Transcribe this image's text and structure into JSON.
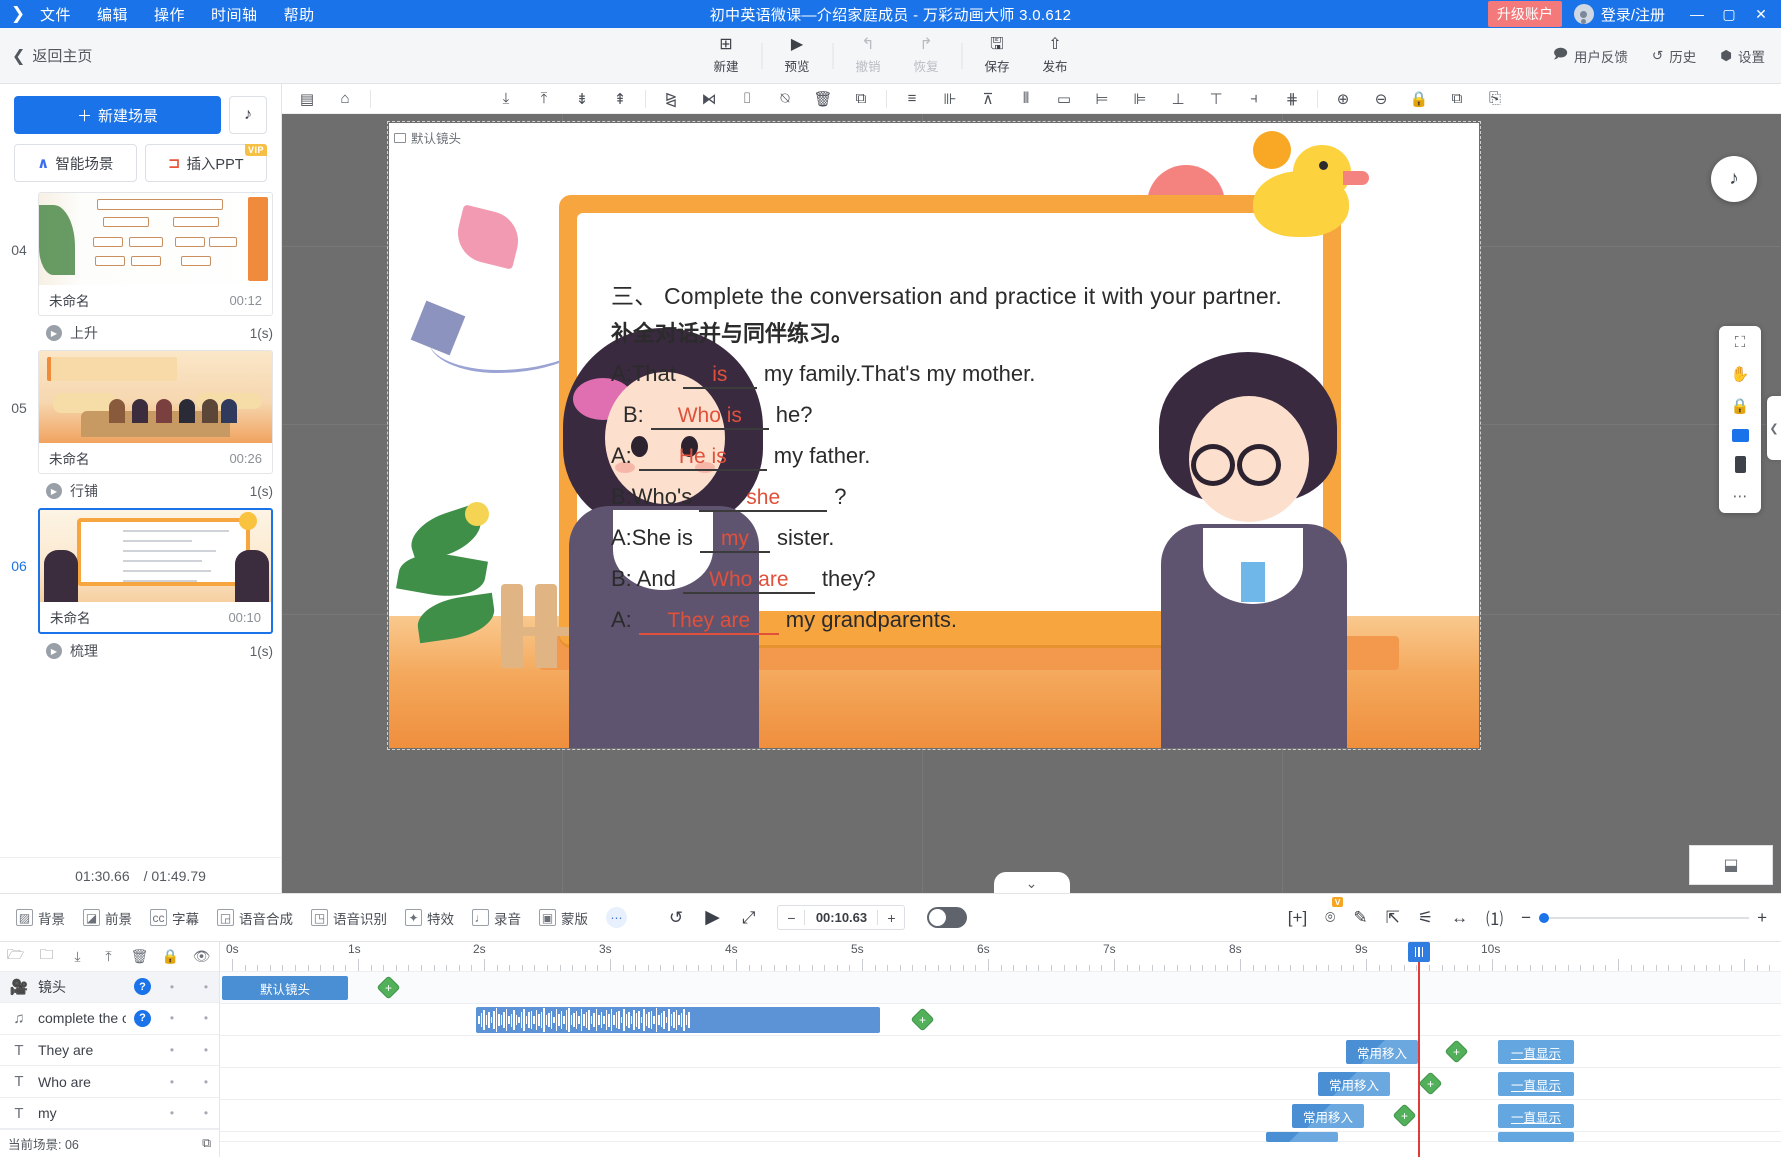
{
  "titlebar": {
    "menus": [
      "文件",
      "编辑",
      "操作",
      "时间轴",
      "帮助"
    ],
    "window_title": "初中英语微课—介绍家庭成员 - 万彩动画大师 3.0.612",
    "upgrade_label": "升级账户",
    "account_label": "登录/注册",
    "minimize": "—",
    "maximize": "▢",
    "close": "✕",
    "accent": "#1a73e8",
    "upgrade_color": "#f4797b"
  },
  "toolbar": {
    "back_label": "返回主页",
    "items": [
      {
        "label": "新建",
        "icon": "plus-square-icon",
        "disabled": false
      },
      {
        "label": "预览",
        "icon": "play-icon",
        "disabled": false
      },
      {
        "label": "撤销",
        "icon": "undo-icon",
        "disabled": true
      },
      {
        "label": "恢复",
        "icon": "redo-icon",
        "disabled": true
      },
      {
        "label": "保存",
        "icon": "save-icon",
        "disabled": false
      },
      {
        "label": "发布",
        "icon": "upload-icon",
        "disabled": false
      }
    ],
    "right_items": [
      {
        "label": "用户反馈",
        "icon": "feedback-icon"
      },
      {
        "label": "历史",
        "icon": "history-icon"
      },
      {
        "label": "设置",
        "icon": "gear-icon"
      }
    ]
  },
  "left_panel": {
    "new_scene_label": "新建场景",
    "music_icon": "music-note-icon",
    "smart_scene_label": "智能场景",
    "insert_ppt_label": "插入PPT",
    "vip_badge": "VIP",
    "scenes": [
      {
        "num": "04",
        "name": "未命名",
        "duration": "00:12",
        "transition": "上升",
        "trans_time": "1(s)",
        "selected": false
      },
      {
        "num": "05",
        "name": "未命名",
        "duration": "00:26",
        "transition": "行铺",
        "trans_time": "1(s)",
        "selected": false
      },
      {
        "num": "06",
        "name": "未命名",
        "duration": "00:10",
        "transition": "梳理",
        "trans_time": "1(s)",
        "selected": true
      }
    ],
    "current_time": "01:30.66",
    "total_time": "/ 01:49.79"
  },
  "canvas_tools": {
    "left_icons": [
      "layout-icon",
      "home-icon"
    ],
    "icons": [
      "align-bottom-icon",
      "align-top-icon",
      "push-down-icon",
      "push-up-icon",
      "flip-horizontal-icon",
      "flip-vertical-icon",
      "lock-icon",
      "unlock-icon",
      "delete-icon",
      "select-all-icon",
      "align-left-icon",
      "align-center-icon",
      "distribute-icon",
      "align-right-icon",
      "crop-icon",
      "indent-left-icon",
      "indent-right-icon",
      "align-middle-icon",
      "align-v-top-icon",
      "align-v-bottom-icon",
      "distribute-v-icon",
      "zoom-in-icon",
      "zoom-out-icon",
      "lock2-icon",
      "copy-icon",
      "paste-icon"
    ]
  },
  "slide": {
    "camera_tag": "默认镜头",
    "heading_num": "三、",
    "heading_en": "Complete the conversation and practice it with your partner.",
    "heading_cn": "补全对话并与同伴练习。",
    "lines": [
      {
        "pre": "A:That",
        "blank": "is",
        "post": "my family.That's my mother."
      },
      {
        "pre": "B:",
        "blank": "Who is",
        "post": "he?"
      },
      {
        "pre": "A:",
        "blank": "He is",
        "post": "my father."
      },
      {
        "pre": "B:Who's",
        "blank": "she",
        "post": "?"
      },
      {
        "pre": "A:She is",
        "blank": "my",
        "post": "sister."
      },
      {
        "pre": "B: And",
        "blank": "Who are",
        "post": "they?"
      },
      {
        "pre": "A:",
        "blank": "They  are",
        "post": "my grandparents."
      }
    ],
    "blank_color": "#e0503a"
  },
  "bottombar": {
    "left_items": [
      {
        "label": "背景",
        "icon": "background-icon"
      },
      {
        "label": "前景",
        "icon": "foreground-icon"
      },
      {
        "label": "字幕",
        "icon": "subtitle-cc-icon"
      },
      {
        "label": "语音合成",
        "icon": "tts-icon"
      },
      {
        "label": "语音识别",
        "icon": "asr-icon"
      },
      {
        "label": "特效",
        "icon": "effects-icon"
      },
      {
        "label": "录音",
        "icon": "microphone-icon"
      },
      {
        "label": "蒙版",
        "icon": "mask-icon"
      }
    ],
    "more_icon": "more-dots-icon",
    "replay_icon": "replay-icon",
    "play_icon": "play-icon",
    "fullscreen_icon": "expand-icon",
    "minus": "−",
    "plus": "+",
    "time_value": "00:10.63",
    "toggle_on": false,
    "right_icons": [
      {
        "icon": "fit-icon",
        "badge": ""
      },
      {
        "icon": "camera-icon",
        "badge": "V"
      },
      {
        "icon": "edit-icon",
        "badge": ""
      },
      {
        "icon": "filter-tree-icon",
        "badge": ""
      },
      {
        "icon": "sliders-icon",
        "badge": ""
      },
      {
        "icon": "expand-h-icon",
        "badge": ""
      },
      {
        "icon": "number-one-icon",
        "badge": ""
      }
    ],
    "zoom_minus": "−",
    "zoom_plus": "+"
  },
  "timeline": {
    "tools": [
      "import-folder-icon",
      "new-folder-icon",
      "move-down-icon",
      "move-up-icon",
      "delete-icon",
      "lock-icon",
      "eye-icon"
    ],
    "tracks": [
      {
        "name": "镜头",
        "icon": "camera-track-icon",
        "has_q": true,
        "active": true
      },
      {
        "name": "complete the conv",
        "icon": "music-track-icon",
        "has_q": true,
        "active": false
      },
      {
        "name": "They  are",
        "icon": "text-track-icon",
        "has_q": false,
        "active": false
      },
      {
        "name": "Who are",
        "icon": "text-track-icon",
        "has_q": false,
        "active": false
      },
      {
        "name": "my",
        "icon": "text-track-icon",
        "has_q": false,
        "active": false
      }
    ],
    "status_label": "当前场景: 06",
    "status_icon": "duplicate-icon",
    "ruler_ticks": [
      "0s",
      "1s",
      "2s",
      "3s",
      "4s",
      "5s",
      "6s",
      "7s",
      "8s",
      "9s",
      "10s"
    ],
    "camera_clip_label": "默认镜头",
    "enter_label": "常用移入",
    "always_label": "一直显示",
    "playhead_time": "00:10.63"
  }
}
